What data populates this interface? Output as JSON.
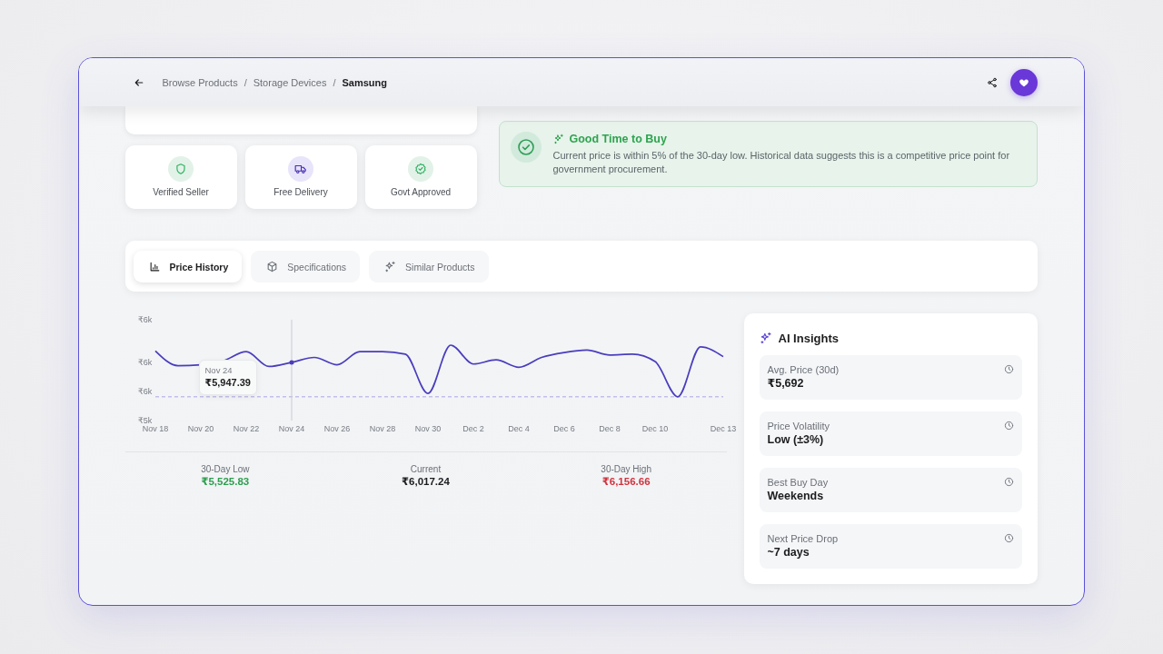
{
  "header": {
    "breadcrumb": {
      "separator": "/",
      "items": [
        {
          "label": "Browse Products",
          "current": false
        },
        {
          "label": "Storage Devices",
          "current": false
        },
        {
          "label": "Samsung",
          "current": true
        }
      ]
    },
    "favorite": {
      "on": true
    }
  },
  "features": [
    {
      "label": "Verified Seller",
      "kind": "shield",
      "color": "#e2f2e8"
    },
    {
      "label": "Free Delivery",
      "kind": "truck",
      "color": "#e8e4fa"
    },
    {
      "label": "Govt Approved",
      "kind": "badge",
      "color": "#e2f2e8"
    }
  ],
  "recommendation": {
    "title": "Good Time to Buy",
    "text": "Current price is within 5% of the 30-day low. Historical data suggests this is a competitive price point for government procurement."
  },
  "tabs": [
    {
      "label": "Price History",
      "kind": "chart",
      "selected": true
    },
    {
      "label": "Specifications",
      "kind": "cube",
      "selected": false
    },
    {
      "label": "Similar Products",
      "kind": "sparkle",
      "selected": false
    }
  ],
  "price_history": {
    "chart_data": {
      "type": "line",
      "categories": [
        "Nov 18",
        null,
        "Nov 20",
        null,
        "Nov 22",
        null,
        "Nov 24",
        null,
        "Nov 26",
        null,
        "Nov 28",
        null,
        "Nov 30",
        null,
        "Dec 2",
        null,
        "Dec 4",
        null,
        "Dec 6",
        null,
        "Dec 8",
        null,
        "Dec 10",
        null,
        null,
        "Dec 13"
      ],
      "values": [
        6090,
        5910,
        5920,
        5970,
        6080,
        5900,
        5950,
        6010,
        5920,
        6080,
        6080,
        6050,
        5570,
        6160,
        5930,
        5980,
        5890,
        6010,
        6070,
        6100,
        6040,
        6050,
        5960,
        5530,
        6140,
        6020
      ],
      "ylim": [
        5240,
        6470
      ],
      "yticks": [
        {
          "value": 6470,
          "label": "₹6k"
        },
        {
          "value": 5950,
          "label": "₹6k"
        },
        {
          "value": 5595,
          "label": "₹6k"
        },
        {
          "value": 5240,
          "label": "₹5k"
        }
      ],
      "ref_lines": [
        {
          "axis": "y",
          "value": 5530
        }
      ],
      "annotations": [
        {
          "x": "Nov 24"
        },
        "Nov 24",
        "₹5,947.39"
      ]
    },
    "stats": [
      {
        "label": "30-Day Low",
        "value": "₹5,525.83",
        "color": "#2e9e4f"
      },
      {
        "label": "Current",
        "value": "₹6,017.24",
        "color": "#1c1c1e"
      },
      {
        "label": "30-Day High",
        "value": "₹6,156.66",
        "color": "#d0343f"
      }
    ]
  },
  "ai_insights": {
    "title": "AI Insights",
    "items": [
      {
        "label": "Avg. Price (30d)",
        "value": "₹5,692"
      },
      {
        "label": "Price Volatility",
        "value": "Low (±3%)"
      },
      {
        "label": "Best Buy Day",
        "value": "Weekends"
      },
      {
        "label": "Next Price Drop",
        "value": "~7 days"
      }
    ]
  }
}
